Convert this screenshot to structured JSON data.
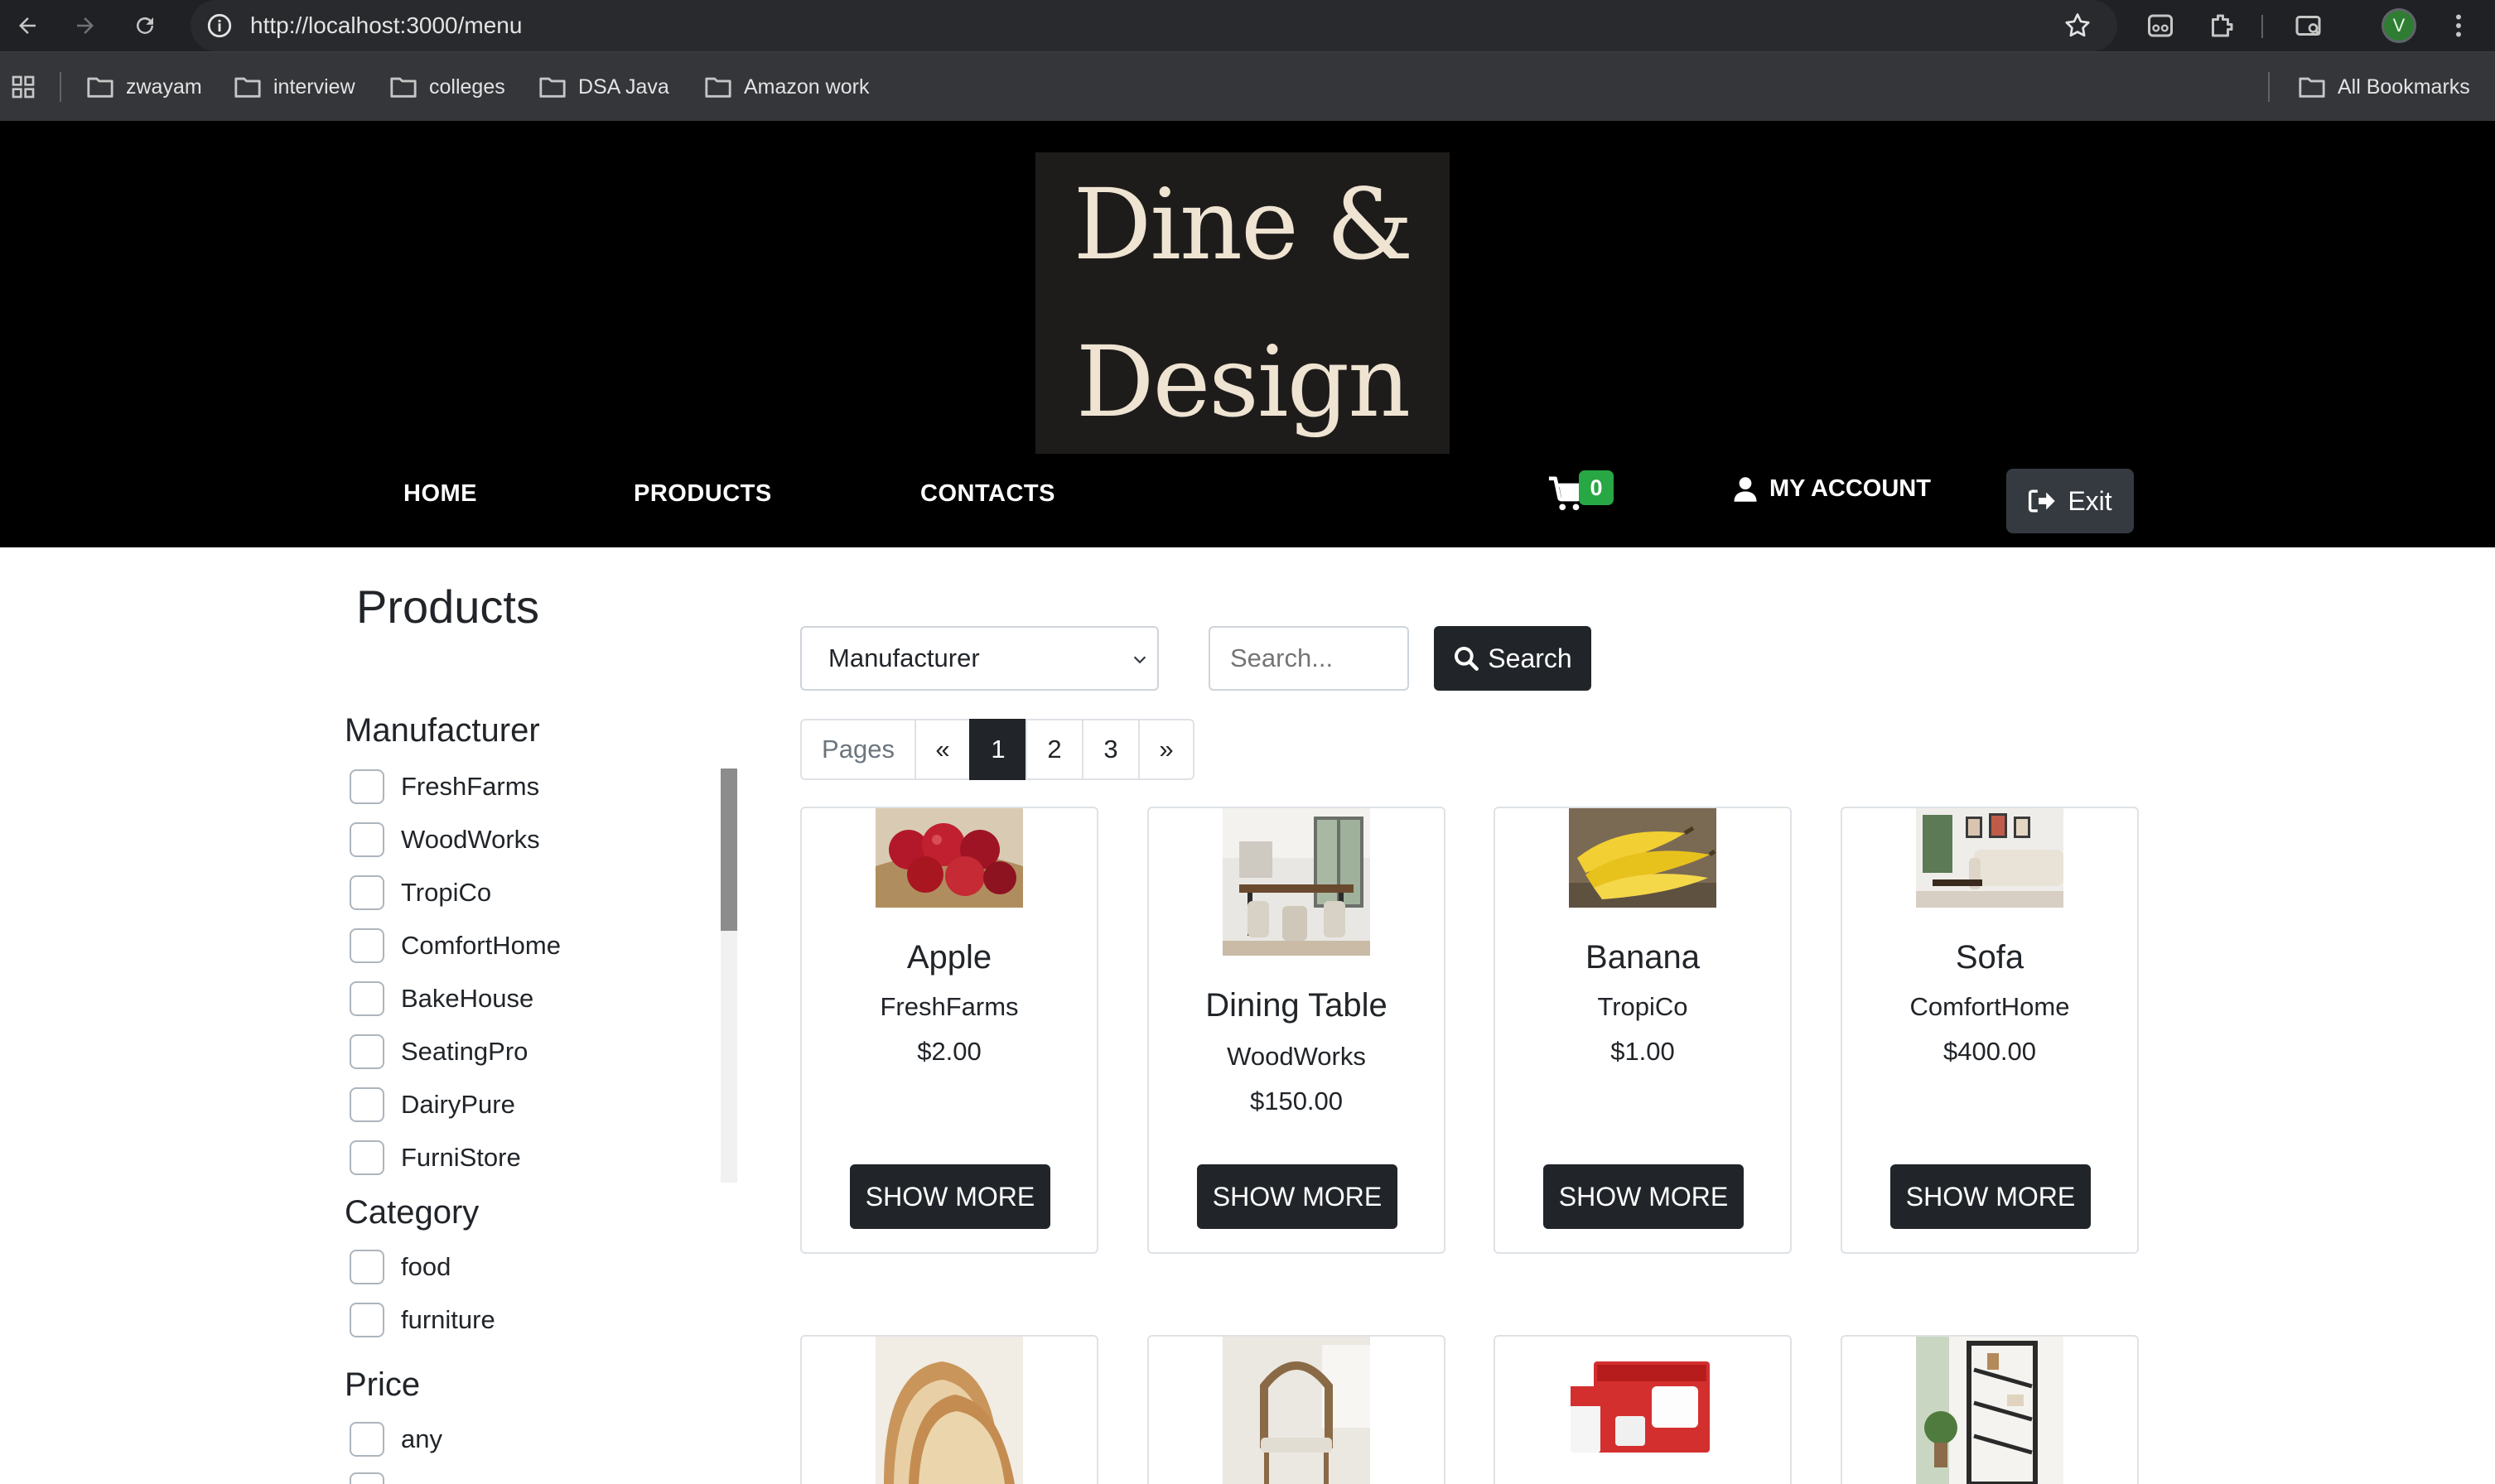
{
  "browser": {
    "url": "http://localhost:3000/menu",
    "profile_initial": "V",
    "bookmarks": [
      "zwayam",
      "interview",
      "colleges",
      "DSA Java",
      "Amazon work"
    ],
    "all_bookmarks": "All Bookmarks"
  },
  "brand": {
    "line1": "Dine &",
    "line2": "Design",
    "logo_bg": "#1e1c1b",
    "logo_text_color": "#efe3d2"
  },
  "nav": {
    "home": "HOME",
    "products": "PRODUCTS",
    "contacts": "CONTACTS",
    "cart_count": "0",
    "account": "MY ACCOUNT",
    "exit": "Exit"
  },
  "sidebar": {
    "title": "Products",
    "manufacturer_heading": "Manufacturer",
    "manufacturers": [
      "FreshFarms",
      "WoodWorks",
      "TropiCo",
      "ComfortHome",
      "BakeHouse",
      "SeatingPro",
      "DairyPure",
      "FurniStore"
    ],
    "category_heading": "Category",
    "categories": [
      "food",
      "furniture"
    ],
    "price_heading": "Price",
    "prices": [
      "any"
    ]
  },
  "toolbar": {
    "select_value": "Manufacturer",
    "search_placeholder": "Search...",
    "search_button": "Search"
  },
  "pagination": {
    "label": "Pages",
    "prev": "«",
    "pages": [
      "1",
      "2",
      "3"
    ],
    "next": "»",
    "active_page": "1"
  },
  "products": [
    {
      "name": "Apple",
      "manufacturer": "FreshFarms",
      "price": "$2.00",
      "button": "SHOW MORE"
    },
    {
      "name": "Dining Table",
      "manufacturer": "WoodWorks",
      "price": "$150.00",
      "button": "SHOW MORE"
    },
    {
      "name": "Banana",
      "manufacturer": "TropiCo",
      "price": "$1.00",
      "button": "SHOW MORE"
    },
    {
      "name": "Sofa",
      "manufacturer": "ComfortHome",
      "price": "$400.00",
      "button": "SHOW MORE"
    }
  ],
  "colors": {
    "header_bg": "#000000",
    "button_dark": "#212529",
    "badge_green": "#28a745"
  }
}
